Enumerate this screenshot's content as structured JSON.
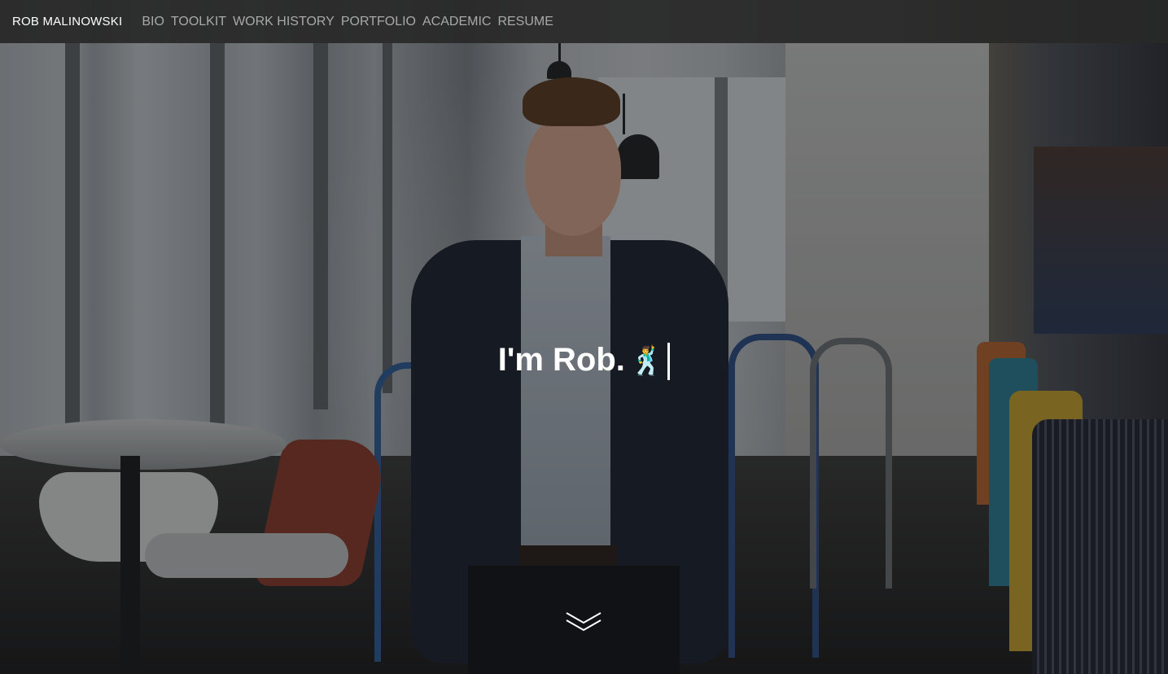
{
  "navbar": {
    "brand": "ROB MALINOWSKI",
    "links": [
      {
        "label": "BIO"
      },
      {
        "label": "TOOLKIT"
      },
      {
        "label": "WORK HISTORY"
      },
      {
        "label": "PORTFOLIO"
      },
      {
        "label": "ACADEMIC"
      },
      {
        "label": "RESUME"
      }
    ]
  },
  "hero": {
    "title": "I'm Rob.",
    "emoji": "🕺",
    "scroll_icon": "double-chevron-down-icon"
  },
  "colors": {
    "navbar_bg": "#282828",
    "nav_link": "#a9a9a9",
    "brand_text": "#ffffff",
    "hero_text": "#ffffff"
  }
}
